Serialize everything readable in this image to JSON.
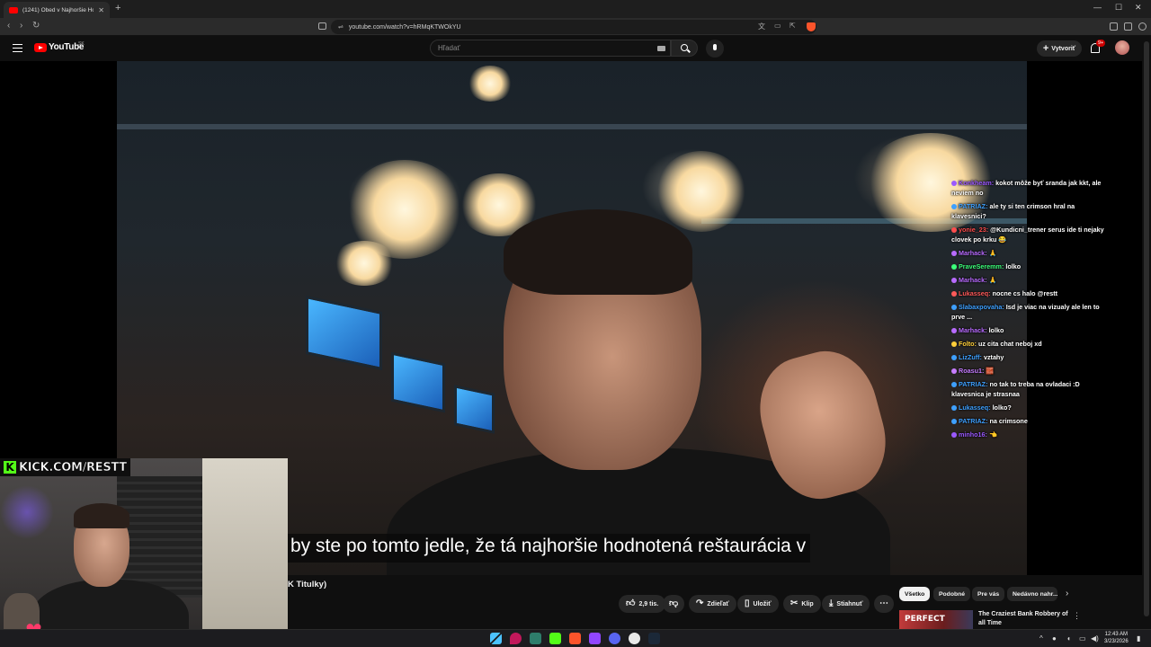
{
  "browser": {
    "tab_title": "(1241) Obed v Najhoršie Hodn...",
    "url": "youtube.com/watch?v=hRMqKTWOkYU"
  },
  "youtube": {
    "logo_text": "YouTube",
    "country_code": "SK",
    "search_placeholder": "Hľadať",
    "create_label": "Vytvoriť",
    "notifications_badge": "9+"
  },
  "video": {
    "subtitle": "by ste po tomto jedle, že tá najhoršie hodnotená reštaurácia v",
    "title_fragment": "K Titulky)",
    "like_count": "2,9 tis.",
    "actions": [
      "Zdieľať",
      "Uložiť",
      "Klip",
      "Stiahnuť"
    ]
  },
  "overlay": {
    "kick_label": "KICK.COM/RESTT"
  },
  "chat": [
    {
      "user": "Konkheam:",
      "text": "kokot môže byť sranda jak kkt, ale neviem no",
      "color": "#9b59ff"
    },
    {
      "user": "PATRIAZ:",
      "text": "ale ty si ten crimson hral na klavesnici?",
      "color": "#3ea0ff"
    },
    {
      "user": "yonie_23:",
      "text": "@Kundicni_trener serus ide ti nejaky clovek po krku 😂",
      "color": "#ff4d4d"
    },
    {
      "user": "Marhack:",
      "text": "🙏",
      "color": "#b86bff"
    },
    {
      "user": "PraveSeremm:",
      "text": "lolko",
      "color": "#3cff7a"
    },
    {
      "user": "Marhack:",
      "text": "🙏",
      "color": "#b86bff"
    },
    {
      "user": "Lukasseq:",
      "text": "nocne cs halo @restt",
      "color": "#ff5a5a"
    },
    {
      "user": "Slabaxpovaha:",
      "text": "Isd je viac na vizualy ale len to prve ...",
      "color": "#3ea0ff"
    },
    {
      "user": "Marhack:",
      "text": "lolko",
      "color": "#b86bff"
    },
    {
      "user": "Folto:",
      "text": "uz cita chat neboj xd",
      "color": "#ffcf3a"
    },
    {
      "user": "LizZuff:",
      "text": "vztahy",
      "color": "#3ea0ff"
    },
    {
      "user": "Roasu1:",
      "text": "🧱",
      "color": "#c77dff"
    },
    {
      "user": "PATRIAZ:",
      "text": "no tak to treba na ovladaci :D klavesnica je strasnaa",
      "color": "#3ea0ff"
    },
    {
      "user": "Lukasseq:",
      "text": "lolko?",
      "color": "#3ea0ff"
    },
    {
      "user": "PATRIAZ:",
      "text": "na crimsone",
      "color": "#3ea0ff"
    },
    {
      "user": "minho16:",
      "text": "👈",
      "color": "#9b59ff"
    }
  ],
  "chips": [
    "Všetko",
    "Podobné",
    "Pre vás",
    "Nedávno nahr..."
  ],
  "recommendation": {
    "thumb_text": "PERFECT",
    "title": "The Craziest Bank Robbery of all Time"
  },
  "taskbar": {
    "time": "12:43 AM",
    "date": "3/23/2026"
  },
  "colors": {
    "youtube_red": "#ff0000",
    "kick_green": "#53fc18",
    "background": "#0f0f0f"
  }
}
